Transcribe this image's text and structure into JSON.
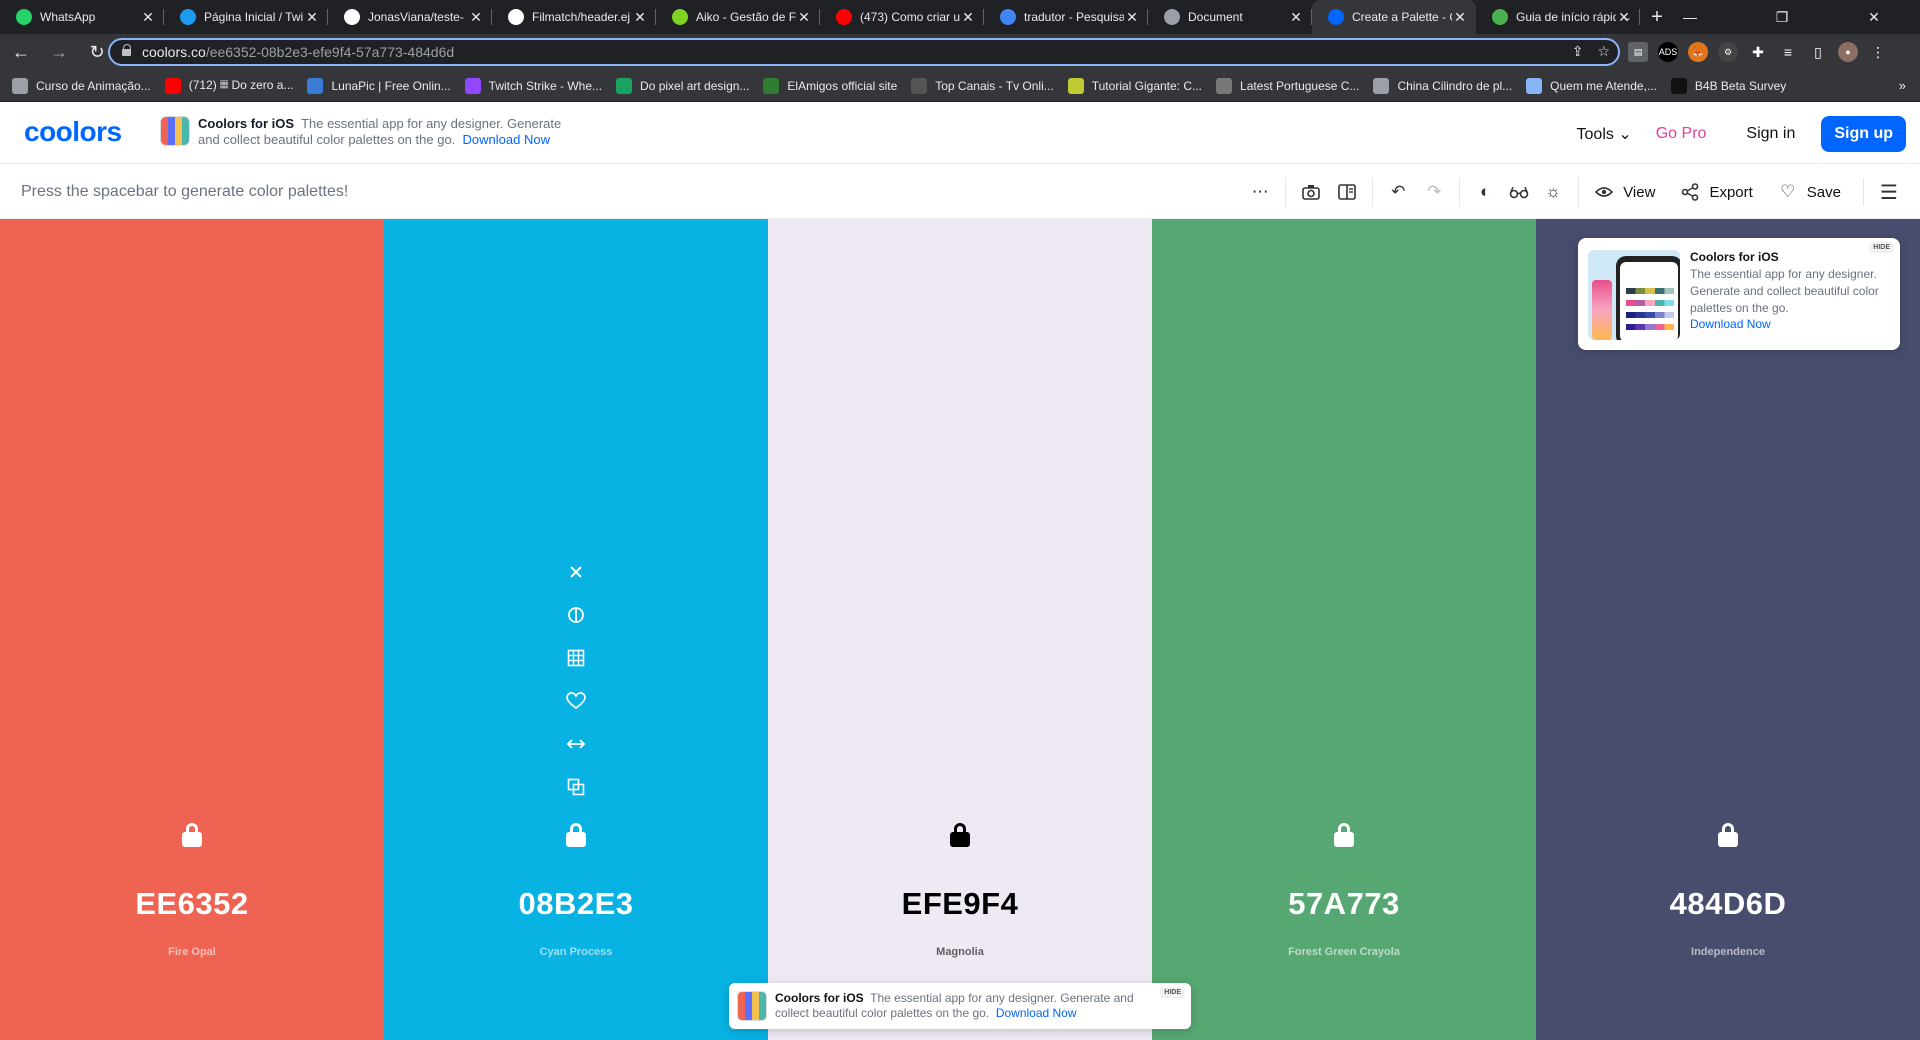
{
  "browser": {
    "tabs": [
      {
        "title": "WhatsApp",
        "favicon": "whatsapp-icon",
        "color": "#25d366"
      },
      {
        "title": "Página Inicial / Twi",
        "favicon": "twitter-icon",
        "color": "#1d9bf0"
      },
      {
        "title": "JonasViana/teste-",
        "favicon": "github-icon",
        "color": "#ffffff"
      },
      {
        "title": "Filmatch/header.ej",
        "favicon": "github-icon",
        "color": "#ffffff"
      },
      {
        "title": "Aiko - Gestão de F",
        "favicon": "checkmark-icon",
        "color": "#7ed321"
      },
      {
        "title": "(473) Como criar u",
        "favicon": "youtube-icon",
        "color": "#ff0000"
      },
      {
        "title": "tradutor - Pesquisa",
        "favicon": "google-icon",
        "color": "#4285f4"
      },
      {
        "title": "Document",
        "favicon": "globe-icon",
        "color": "#9aa0a6"
      },
      {
        "title": "Create a Palette - C",
        "favicon": "coolors-icon",
        "color": "#0066ff",
        "active": true
      },
      {
        "title": "Guia de início rápid",
        "favicon": "leaf-icon",
        "color": "#4caf50"
      }
    ],
    "url_host": "coolors.co",
    "url_path": "/ee6352-08b2e3-efe9f4-57a773-484d6d",
    "bookmarks": [
      {
        "label": "Curso de Animação...",
        "icon": "globe-icon",
        "color": "#9aa0a6"
      },
      {
        "label": "(712) 𝄜 Do zero a...",
        "icon": "youtube-icon",
        "color": "#ff0000"
      },
      {
        "label": "LunaPic | Free Onlin...",
        "icon": "lunapic-icon",
        "color": "#3a7bd5"
      },
      {
        "label": "Twitch Strike - Whe...",
        "icon": "twitch-icon",
        "color": "#9146ff"
      },
      {
        "label": "Do pixel art design...",
        "icon": "fi-icon",
        "color": "#1aa260"
      },
      {
        "label": "ElAmigos official site",
        "icon": "elamigos-icon",
        "color": "#2e7d32"
      },
      {
        "label": "Top Canais - Tv Onli...",
        "icon": "tv-icon",
        "color": "#555555"
      },
      {
        "label": "Tutorial Gigante: C...",
        "icon": "bulb-icon",
        "color": "#c0ca33"
      },
      {
        "label": "Latest Portuguese C...",
        "icon": "tools-icon",
        "color": "#777777"
      },
      {
        "label": "China Cilindro de pl...",
        "icon": "globe-icon",
        "color": "#9aa0a6"
      },
      {
        "label": "Quem me Atende,...",
        "icon": "search-icon",
        "color": "#8ab4f8"
      },
      {
        "label": "B4B Beta Survey",
        "icon": "circle-icon",
        "color": "#111111"
      }
    ]
  },
  "header": {
    "logo": "coolors",
    "ios_title": "Coolors for iOS",
    "ios_text": "The essential app for any designer. Generate and collect beautiful color palettes on the go.",
    "ios_download": "Download Now",
    "tools": "Tools",
    "go_pro": "Go Pro",
    "sign_in": "Sign in",
    "sign_up": "Sign up"
  },
  "toolbar": {
    "hint": "Press the spacebar to generate color palettes!",
    "view": "View",
    "export": "Export",
    "save": "Save"
  },
  "palette": [
    {
      "hex": "EE6352",
      "name": "Fire Opal",
      "color": "#ee6352",
      "text_color": "#ffffff",
      "locked": false
    },
    {
      "hex": "08B2E3",
      "name": "Cyan Process",
      "color": "#08b2e3",
      "text_color": "#ffffff",
      "locked": false,
      "hovered": true
    },
    {
      "hex": "EFE9F4",
      "name": "Magnolia",
      "color": "#efe9f4",
      "text_color": "#000000",
      "locked": false
    },
    {
      "hex": "57A773",
      "name": "Forest Green Crayola",
      "color": "#57a773",
      "text_color": "#ffffff",
      "locked": false
    },
    {
      "hex": "484D6D",
      "name": "Independence",
      "color": "#484d6d",
      "text_color": "#ffffff",
      "locked": false
    }
  ],
  "promo_card": {
    "title": "Coolors for iOS",
    "text": "The essential app for any designer. Generate and collect beautiful color palettes on the go.",
    "download": "Download Now",
    "hide": "HIDE"
  },
  "bottom_promo": {
    "title": "Coolors for iOS",
    "text": "The essential app for any designer. Generate and collect beautiful color palettes on the go.",
    "download": "Download Now",
    "hide": "HIDE"
  }
}
